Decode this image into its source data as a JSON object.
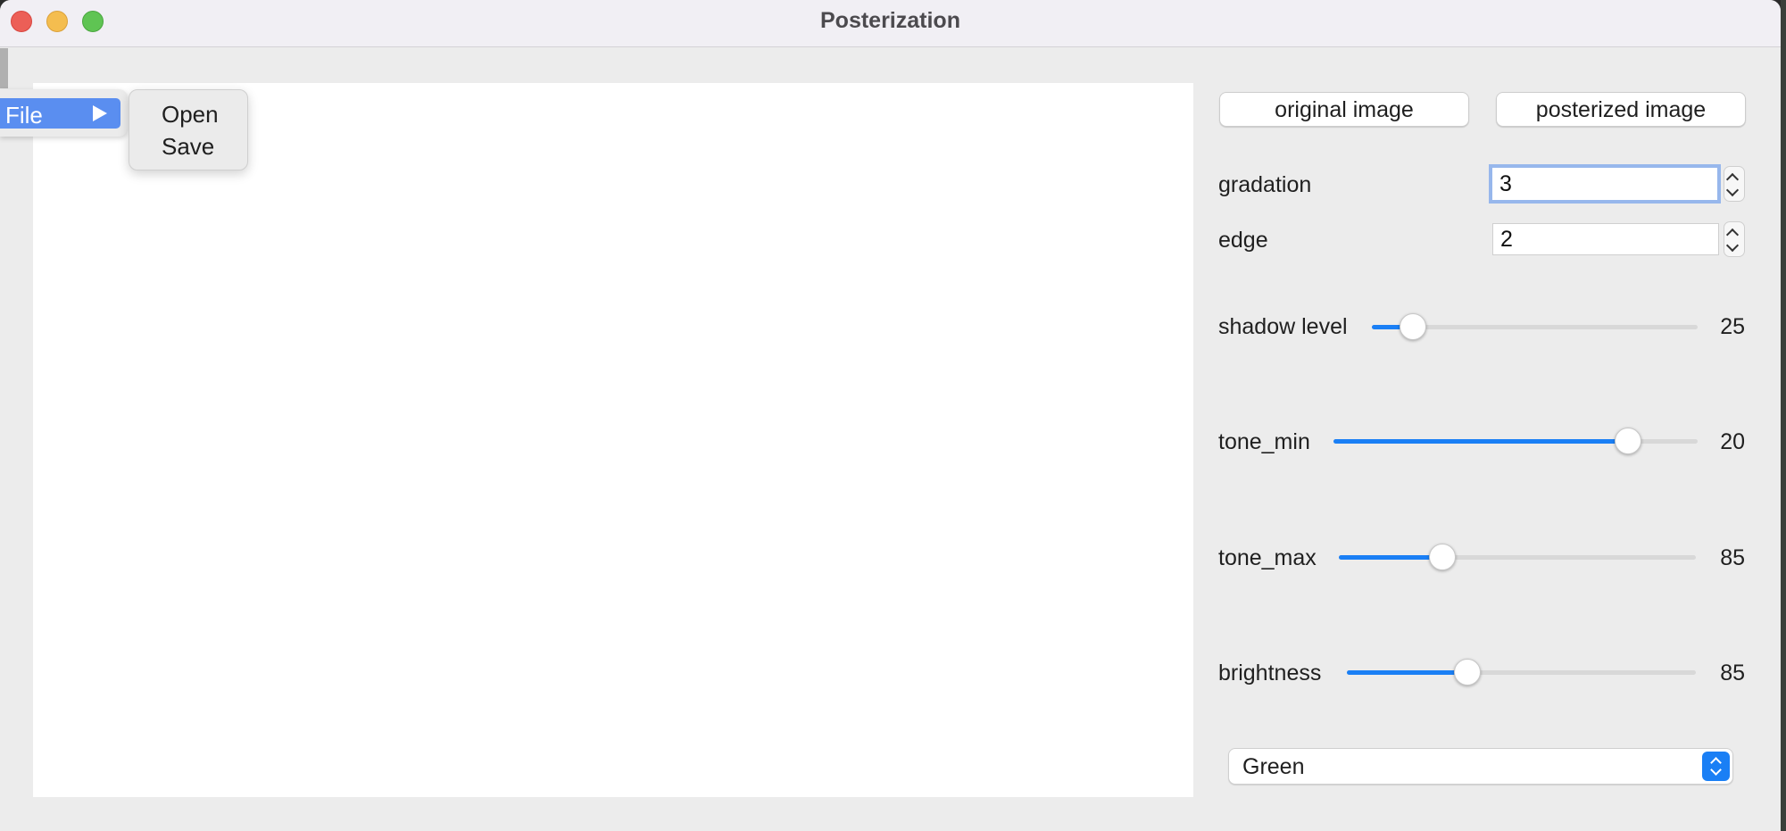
{
  "window": {
    "title": "Posterization"
  },
  "menu": {
    "file_label": "File",
    "submenu": [
      {
        "label": "Open"
      },
      {
        "label": "Save"
      }
    ]
  },
  "buttons": {
    "original": "original image",
    "posterized": "posterized image"
  },
  "spinners": {
    "gradation": {
      "label": "gradation",
      "value": "3"
    },
    "edge": {
      "label": "edge",
      "value": "2"
    }
  },
  "sliders": {
    "shadow_level": {
      "label": "shadow level",
      "value": "25",
      "fraction": 0.125
    },
    "tone_min": {
      "label": "tone_min",
      "value": "20",
      "fraction": 0.81
    },
    "tone_max": {
      "label": "tone_max",
      "value": "85",
      "fraction": 0.29
    },
    "brightness": {
      "label": "brightness",
      "value": "85",
      "fraction": 0.345
    }
  },
  "channel_select": {
    "value": "Green"
  },
  "colors": {
    "accent": "#1a7ff5",
    "menu_highlight": "#5a8ef0",
    "focus_ring": "#97b7ec"
  }
}
